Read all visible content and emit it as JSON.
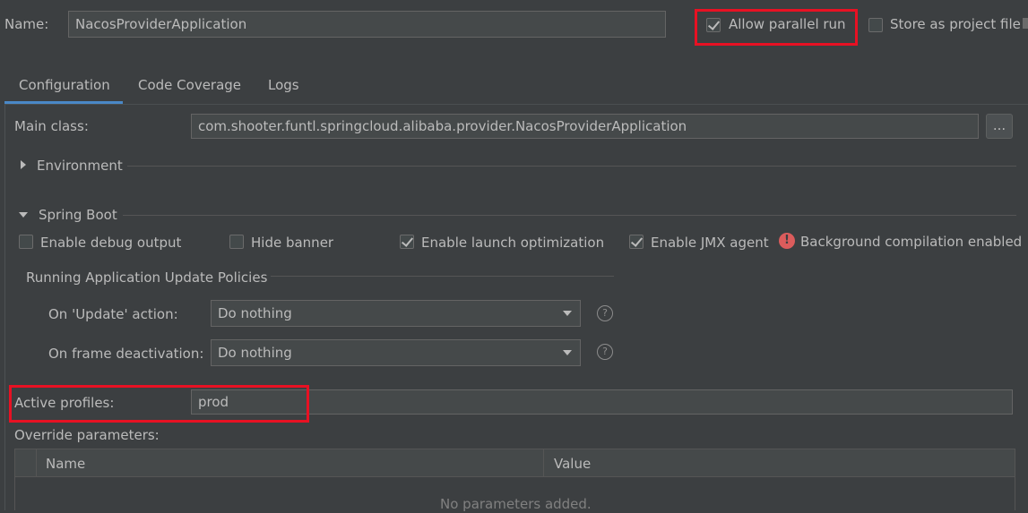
{
  "header": {
    "name_label": "Name:",
    "name_value": "NacosProviderApplication",
    "allow_parallel_run": {
      "label": "Allow parallel run",
      "checked": true
    },
    "store_as_project_file": {
      "label": "Store as project file",
      "checked": false
    }
  },
  "tabs": [
    {
      "label": "Configuration",
      "active": true
    },
    {
      "label": "Code Coverage",
      "active": false
    },
    {
      "label": "Logs",
      "active": false
    }
  ],
  "main_class": {
    "label": "Main class:",
    "value": "com.shooter.funtl.springcloud.alibaba.provider.NacosProviderApplication",
    "browse_label": "..."
  },
  "environment": {
    "label": "Environment"
  },
  "spring_boot": {
    "label": "Spring Boot",
    "options": [
      {
        "label": "Enable debug output",
        "checked": false
      },
      {
        "label": "Hide banner",
        "checked": false
      },
      {
        "label": "Enable launch optimization",
        "checked": true
      },
      {
        "label": "Enable JMX agent",
        "checked": true
      }
    ],
    "warning": "Background compilation enabled",
    "update_policies": {
      "title": "Running Application Update Policies",
      "on_update_label": "On 'Update' action:",
      "on_update_value": "Do nothing",
      "on_frame_label": "On frame deactivation:",
      "on_frame_value": "Do nothing"
    }
  },
  "active_profiles": {
    "label": "Active profiles:",
    "value": "prod"
  },
  "override": {
    "label": "Override parameters:",
    "columns": [
      "Name",
      "Value"
    ],
    "empty_text": "No parameters added."
  },
  "colors": {
    "highlight": "#e81123",
    "background": "#3c3f41",
    "tab_underline": "#4a88c7"
  }
}
